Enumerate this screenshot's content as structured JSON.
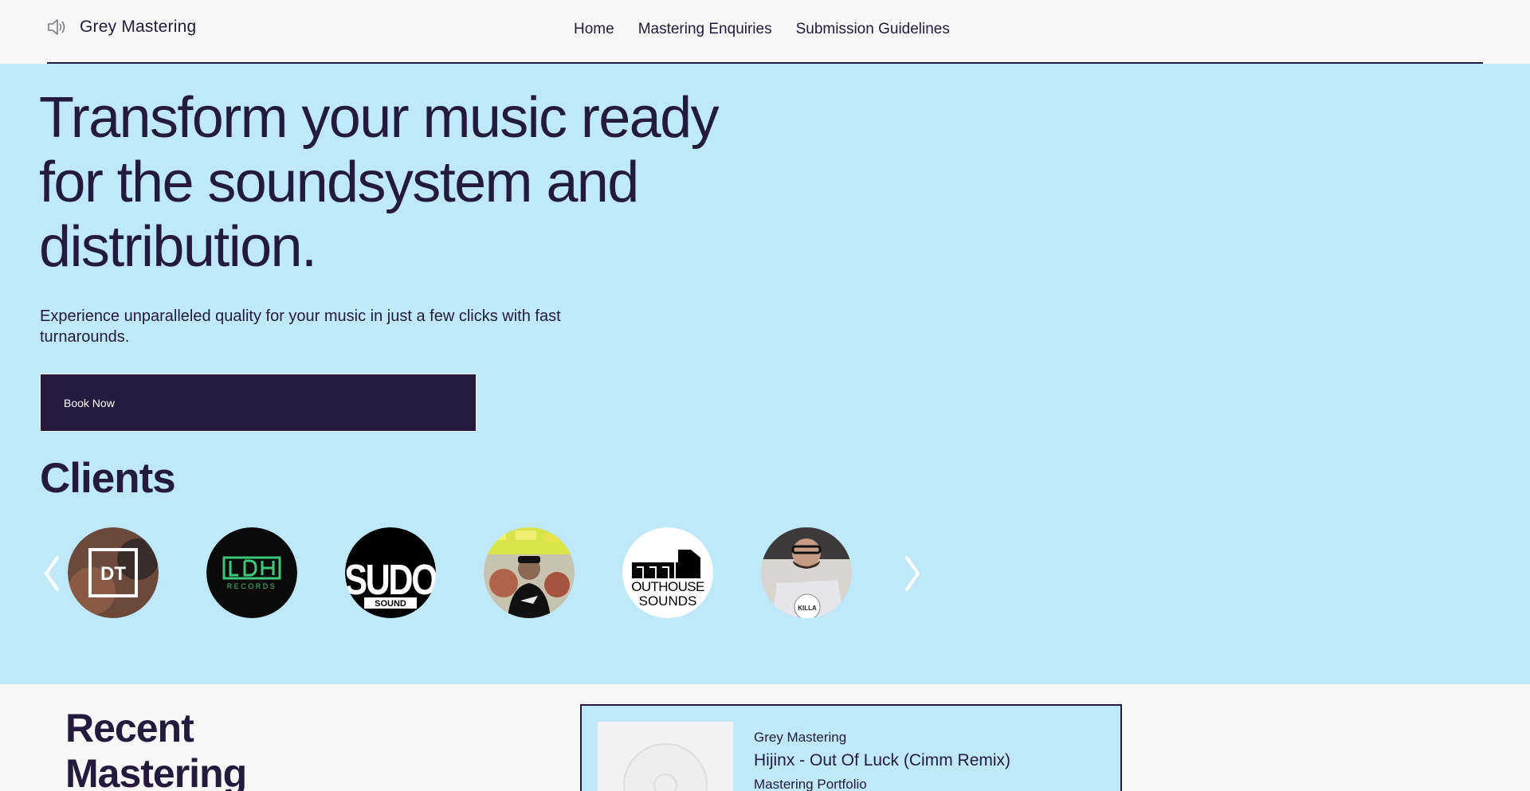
{
  "header": {
    "brand_icon": "speaker-icon",
    "brand_name": "Grey Mastering",
    "nav": [
      "Home",
      "Mastering Enquiries",
      "Submission Guidelines"
    ]
  },
  "hero": {
    "title": "Transform your music ready for the soundsystem and distribution.",
    "subtitle": "Experience unparalleled quality for your music in just a few clicks with fast turnarounds.",
    "cta_label": "Book Now"
  },
  "clients": {
    "title": "Clients",
    "logos": [
      {
        "icon": "dt-logo-icon",
        "text": "DT"
      },
      {
        "icon": "ldh-records-logo-icon",
        "text": "LDH RECORDS"
      },
      {
        "icon": "sudo-sound-logo-icon",
        "text": "SUDO SOUND"
      },
      {
        "icon": "client-photo-icon"
      },
      {
        "icon": "outhouse-sounds-logo-icon",
        "text": "OUTHOUSE SOUNDS"
      },
      {
        "icon": "client-photo-icon"
      }
    ],
    "prev_icon": "chevron-left-icon",
    "next_icon": "chevron-right-icon"
  },
  "recent": {
    "title": "Recent Mastering",
    "card": {
      "artist": "Grey Mastering",
      "track": "Hijinx - Out Of Luck (Cimm Remix)",
      "label": "Mastering Portfolio"
    }
  },
  "colors": {
    "navy": "#241a3d",
    "hero_bg": "#bfe9f9",
    "page_bg": "#f7f7f7"
  }
}
